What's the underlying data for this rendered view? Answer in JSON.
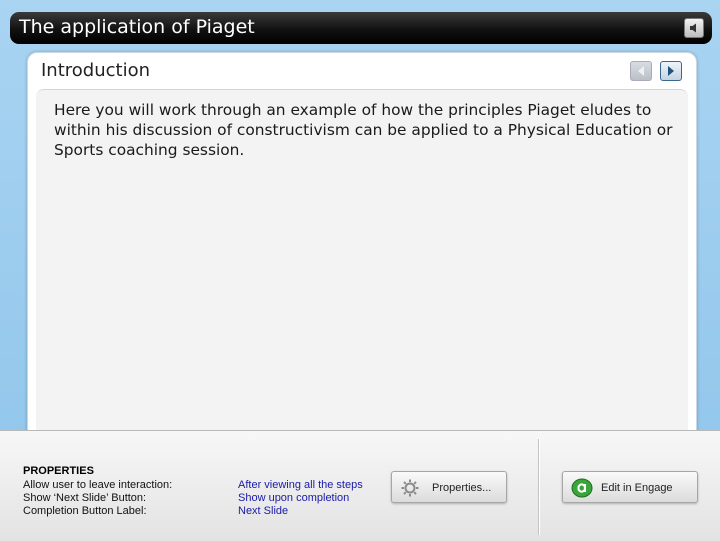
{
  "window": {
    "title": "The application of Piaget",
    "audio_icon": "speaker-icon"
  },
  "slide": {
    "heading": "Introduction",
    "prev_icon": "chevron-left-icon",
    "next_icon": "chevron-right-icon",
    "body": "Here you will work through an example of how the principles Piaget eludes to within his discussion of constructivism can be applied to a Physical Education or Sports coaching session."
  },
  "properties": {
    "heading": "PROPERTIES",
    "rows": [
      {
        "label": "Allow user to leave interaction:",
        "value": "After viewing all the steps"
      },
      {
        "label": "Show ‘Next Slide’ Button:",
        "value": "Show upon completion"
      },
      {
        "label": "Completion Button Label:",
        "value": "Next Slide"
      }
    ],
    "properties_button": "Properties...",
    "properties_icon": "gear-icon",
    "engage_button": "Edit in Engage",
    "engage_icon": "engage-logo-icon"
  },
  "colors": {
    "background": "#8ec4ea",
    "title_bar": "#111111",
    "value_text": "#1a1aa8",
    "engage_green": "#3aa53a"
  }
}
